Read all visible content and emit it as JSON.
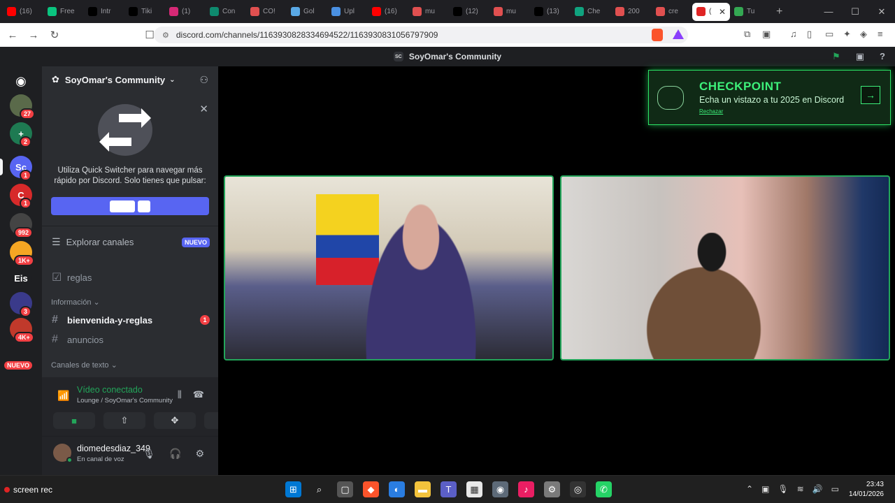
{
  "browser": {
    "tabs": [
      {
        "label": "(16)",
        "favicon_color": "#ff0000"
      },
      {
        "label": "Free",
        "favicon_color": "#0ac47f"
      },
      {
        "label": "Intr",
        "favicon_color": "#000000"
      },
      {
        "label": "Tiki",
        "favicon_color": "#000000"
      },
      {
        "label": "(1)",
        "favicon_color": "#d62976"
      },
      {
        "label": "Con",
        "favicon_color": "#0e8a6e"
      },
      {
        "label": "CO!",
        "favicon_color": "#e05050"
      },
      {
        "label": "Gol",
        "favicon_color": "#5aa9e6"
      },
      {
        "label": "Upl",
        "favicon_color": "#4a90e2"
      },
      {
        "label": "(16)",
        "favicon_color": "#ff0000"
      },
      {
        "label": "mu",
        "favicon_color": "#e05050"
      },
      {
        "label": "(12)",
        "favicon_color": "#000000"
      },
      {
        "label": "mu",
        "favicon_color": "#e05050"
      },
      {
        "label": "(13)",
        "favicon_color": "#000000"
      },
      {
        "label": "Che",
        "favicon_color": "#10a37f"
      },
      {
        "label": "200",
        "favicon_color": "#e05050"
      },
      {
        "label": "cre",
        "favicon_color": "#e05050"
      },
      {
        "label": "(",
        "favicon_color": "#e02424"
      },
      {
        "label": "Tu",
        "favicon_color": "#34a853"
      }
    ],
    "new_tab": "+",
    "url": "discord.com/channels/1163930828334694522/1163930831056797909"
  },
  "discord": {
    "top_title": "SoyOmar's Community",
    "top_server_abbr": "SC",
    "server_rail": [
      {
        "label": "",
        "badge": "27",
        "color": "#5a6a4a"
      },
      {
        "label": "+",
        "badge": "2",
        "color": "#1e7a52"
      },
      {
        "label": "Sc",
        "badge": "1",
        "color": "#5865f2"
      },
      {
        "label": "C",
        "badge": "1",
        "color": "#d72a2a"
      },
      {
        "label": "",
        "badge": "992",
        "color": "#444444"
      },
      {
        "label": "",
        "badge": "1K+",
        "color": "#f5a623"
      },
      {
        "label": "Eis",
        "badge": "",
        "color": "#1e1f22"
      },
      {
        "label": "",
        "badge": "3",
        "color": "#3a3a8a"
      },
      {
        "label": "",
        "badge": "4K+",
        "color": "#c0392b"
      }
    ],
    "rail_new": "NUEVO",
    "sidebar": {
      "server_name": "SoyOmar's Community",
      "quick_switcher_text": "Utiliza Quick Switcher para navegar más rápido por Discord. Solo tienes que pulsar:",
      "explore_label": "Explorar canales",
      "explore_badge": "NUEVO",
      "channels": [
        {
          "name": "reglas",
          "unread": false,
          "count": ""
        },
        {
          "name": "bienvenida-y-reglas",
          "unread": true,
          "count": "1"
        },
        {
          "name": "anuncios",
          "unread": false,
          "count": ""
        }
      ],
      "categories": [
        "Información",
        "Canales de texto"
      ]
    },
    "voice": {
      "title": "Vídeo conectado",
      "subtitle": "Lounge / SoyOmar's Community"
    },
    "user": {
      "name": "diomedesdiaz_349",
      "status": "En canal de voz"
    },
    "checkpoint": {
      "title": "CHECKPOINT",
      "subtitle": "Echa un vistazo a tu 2025 en Discord",
      "dismiss": "Rechazar"
    }
  },
  "taskbar": {
    "recorder_label": "screen rec",
    "time": "23:43",
    "date": "14/01/2026"
  }
}
